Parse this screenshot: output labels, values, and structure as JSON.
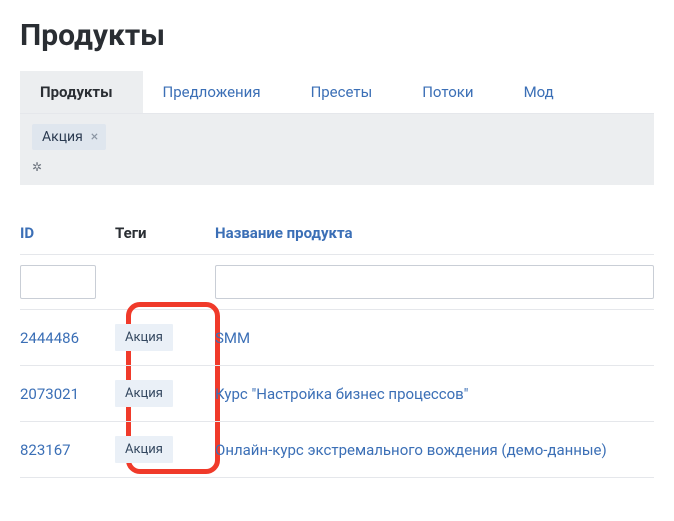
{
  "page": {
    "title": "Продукты"
  },
  "tabs": [
    {
      "label": "Продукты",
      "active": true
    },
    {
      "label": "Предложения",
      "active": false
    },
    {
      "label": "Пресеты",
      "active": false
    },
    {
      "label": "Потоки",
      "active": false
    },
    {
      "label": "Мод",
      "active": false
    }
  ],
  "filter": {
    "tag_label": "Акция"
  },
  "table": {
    "headers": {
      "id": "ID",
      "tags": "Теги",
      "name": "Название продукта"
    },
    "rows": [
      {
        "id": "2444486",
        "tag": "Акция",
        "name": "SMM"
      },
      {
        "id": "2073021",
        "tag": "Акция",
        "name": "Курс \"Настройка бизнес процессов\""
      },
      {
        "id": "823167",
        "tag": "Акция",
        "name": "Онлайн-курс экстремального вождения (демо-данные)"
      }
    ]
  }
}
